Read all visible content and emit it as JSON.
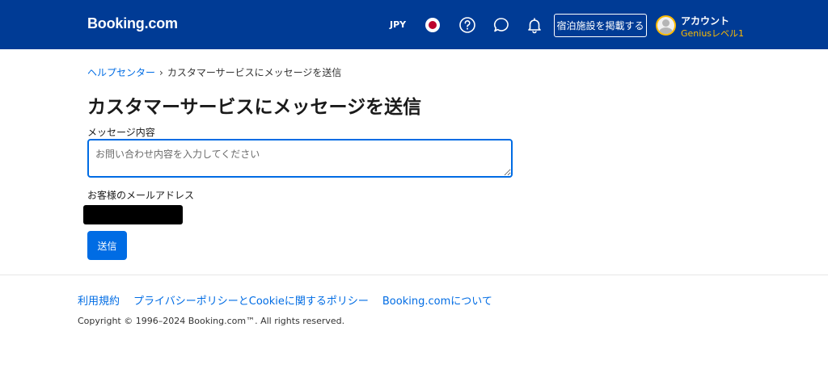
{
  "header": {
    "logo": "Booking.com",
    "currency": "JPY",
    "flag_icon": "japan-flag-icon",
    "icons": [
      "help-icon",
      "chat-icon",
      "bell-icon"
    ],
    "list_property_label": "宿泊施設を掲載する",
    "account_name": "アカウント",
    "account_level": "Geniusレベル1",
    "colors": {
      "bar": "#003b95",
      "accent": "#febb02"
    }
  },
  "breadcrumb": {
    "home": "ヘルプセンター",
    "current": "カスタマーサービスにメッセージを送信"
  },
  "main": {
    "title": "カスタマーサービスにメッセージを送信",
    "message_label": "メッセージ内容",
    "message_placeholder": "お問い合わせ内容を入力してください",
    "message_value": "",
    "email_label": "お客様のメールアドレス",
    "submit_label": "送信",
    "colors": {
      "primary": "#006ce4"
    }
  },
  "footer": {
    "links": [
      "利用規約",
      "プライバシーポリシーとCookieに関するポリシー",
      "Booking.comについて"
    ],
    "copyright": "Copyright © 1996–2024 Booking.com™. All rights reserved."
  }
}
